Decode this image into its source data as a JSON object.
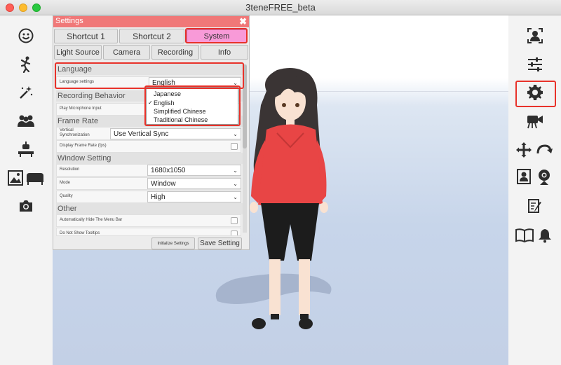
{
  "window": {
    "title": "3teneFREE_beta"
  },
  "settings": {
    "title": "Settings",
    "close_glyph": "✖",
    "top_tabs": [
      "Shortcut 1",
      "Shortcut 2",
      "System"
    ],
    "sub_tabs": [
      "Light Source",
      "Camera",
      "Recording",
      "Info"
    ],
    "sections": {
      "language": "Language",
      "recording": "Recording Behavior",
      "framerate": "Frame Rate",
      "window": "Window Setting",
      "other": "Other"
    },
    "rows": {
      "language_settings": {
        "label": "Language settings",
        "value": "English"
      },
      "play_mic": {
        "label": "Play Microphone Input"
      },
      "vsync": {
        "label_line1": "Vertical",
        "label_line2": "Synchronization",
        "value": "Use Vertical Sync"
      },
      "display_fps": {
        "label": "Display Frame Rate (fps)"
      },
      "resolution": {
        "label": "Resolution",
        "value": "1680x1050"
      },
      "mode": {
        "label": "Mode",
        "value": "Window"
      },
      "quality": {
        "label": "Quality",
        "value": "High"
      },
      "auto_hide": {
        "label": "Automatically Hide The Menu Bar"
      },
      "no_tooltips": {
        "label": "Do Not Show Tooltips"
      }
    },
    "language_dropdown": {
      "options": [
        "Japanese",
        "English",
        "Simplified Chinese",
        "Traditional Chinese"
      ],
      "selected": "English",
      "check_glyph": "✓"
    },
    "buttons": {
      "initialize": "Initialize Settings",
      "save": "Save Setting"
    },
    "caret": "⌄"
  },
  "left_tools": [
    "face-icon",
    "pose-icon",
    "effects-icon",
    "group-icon",
    "furniture-icon",
    "background-icon",
    "camera-icon"
  ],
  "right_tools": [
    "avatar-icon",
    "sliders-icon",
    "gear-icon",
    "video-camera-icon",
    "move-icon",
    "rotate-icon",
    "portrait-icon",
    "webcam-icon",
    "edit-icon",
    "book-icon",
    "bell-icon"
  ],
  "colors": {
    "highlight": "#e8322a",
    "settings_title": "#f07878",
    "active_tab": "#f89ad8"
  }
}
